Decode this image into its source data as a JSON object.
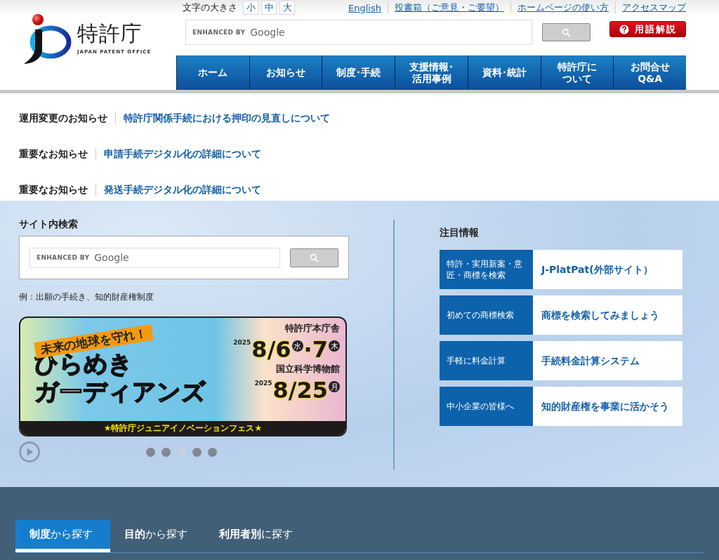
{
  "header": {
    "logo": {
      "name": "特許庁",
      "subtitle": "JAPAN PATENT OFFICE"
    },
    "font_size": {
      "label": "文字の大きさ",
      "options": [
        {
          "label": "小",
          "selected": false
        },
        {
          "label": "中",
          "selected": false
        },
        {
          "label": "大",
          "selected": false
        }
      ]
    },
    "links": [
      "English",
      "投書箱（ご意見・ご要望）",
      "ホームページの使い方",
      "アクセスマップ"
    ],
    "search": {
      "placeholder_prefix": "ENHANCED BY",
      "placeholder_brand": "Google"
    },
    "glossary_button": "用語解説",
    "nav": [
      [
        "ホーム"
      ],
      [
        "お知らせ"
      ],
      [
        "制度･手続"
      ],
      [
        "支援情報･",
        "活用事例"
      ],
      [
        "資料･統計"
      ],
      [
        "特許庁に",
        "ついて"
      ],
      [
        "お問合せ",
        "Q&A"
      ]
    ]
  },
  "notices": [
    {
      "category": "運用変更のお知らせ",
      "link": "特許庁関係手続における押印の見直しについて"
    },
    {
      "category": "重要なお知らせ",
      "link": "申請手続デジタル化の詳細について"
    },
    {
      "category": "重要なお知らせ",
      "link": "発送手続デジタル化の詳細について"
    }
  ],
  "site_search": {
    "title": "サイト内検索",
    "placeholder_prefix": "ENHANCED BY",
    "placeholder_brand": "Google",
    "example": "例：出願の手続き、知的財産権制度"
  },
  "banner": {
    "slogan": "未来の地球を守れ！",
    "title": [
      "ひらめき",
      "ガーディアンズ"
    ],
    "events": [
      {
        "venue": "特許庁本庁舎",
        "year": "2025",
        "parts": [
          {
            "kind": "num",
            "text": "8/6"
          },
          {
            "kind": "day",
            "text": "水"
          },
          {
            "kind": "num",
            "text": "·7"
          },
          {
            "kind": "day",
            "text": "木"
          }
        ]
      },
      {
        "venue": "国立科学博物館",
        "year": "2025",
        "parts": [
          {
            "kind": "num",
            "text": "8/25"
          },
          {
            "kind": "day",
            "text": "月"
          }
        ]
      }
    ],
    "footer": "★特許庁ジュニアイノベーションフェス★"
  },
  "carousel": {
    "dots": [
      {
        "selected": false
      },
      {
        "selected": false
      },
      {
        "selected": true
      },
      {
        "selected": false
      },
      {
        "selected": false
      }
    ]
  },
  "featured": {
    "title": "注目情報",
    "items": [
      {
        "label": "特許・実用新案・意匠・商標を検索",
        "link": "J-PlatPat(外部サイト）"
      },
      {
        "label": "初めての商標検索",
        "link": "商標を検索してみましょう"
      },
      {
        "label": "手軽に料金計算",
        "link": "手続料金計算システム"
      },
      {
        "label": "中小企業の皆様へ",
        "link": "知的財産権を事業に活かそう"
      }
    ]
  },
  "search_tabs": [
    {
      "bold": "制度",
      "rest": "から探す",
      "selected": true
    },
    {
      "bold": "目的",
      "rest": "から探す",
      "selected": false
    },
    {
      "bold": "利用者別",
      "rest": "に探す",
      "selected": false
    }
  ]
}
